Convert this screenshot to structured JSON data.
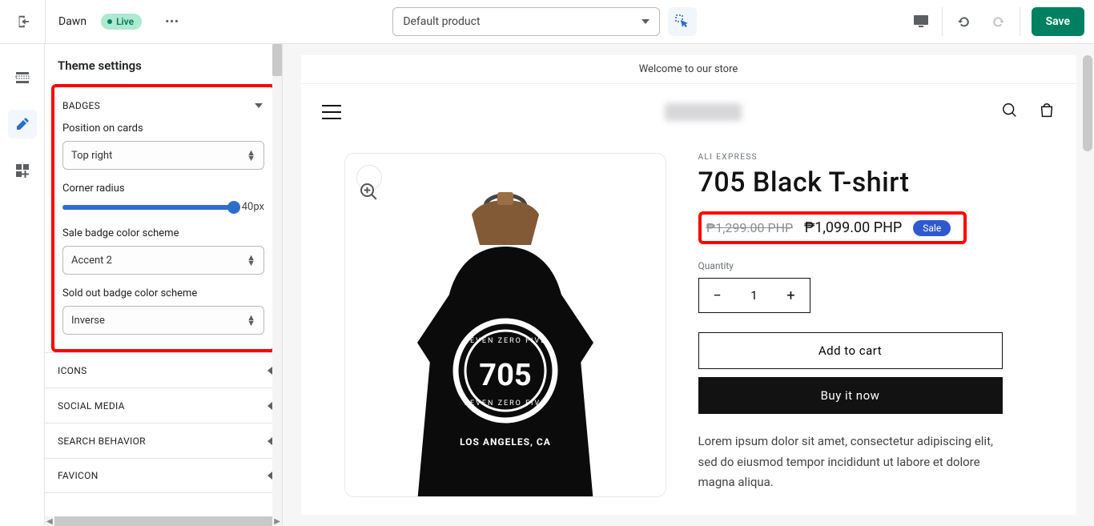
{
  "topbar": {
    "theme_name": "Dawn",
    "status_label": "Live",
    "template_selected": "Default product",
    "save_label": "Save"
  },
  "sidebar": {
    "title": "Theme settings",
    "badges": {
      "header": "BADGES",
      "position_label": "Position on cards",
      "position_value": "Top right",
      "radius_label": "Corner radius",
      "radius_value": "40px",
      "sale_scheme_label": "Sale badge color scheme",
      "sale_scheme_value": "Accent 2",
      "soldout_scheme_label": "Sold out badge color scheme",
      "soldout_scheme_value": "Inverse"
    },
    "sections": [
      "ICONS",
      "SOCIAL MEDIA",
      "SEARCH BEHAVIOR",
      "FAVICON"
    ]
  },
  "preview": {
    "announcement": "Welcome to our store",
    "vendor": "ALI EXPRESS",
    "product_title": "705 Black T-shirt",
    "price_compare": "₱1,299.00 PHP",
    "price": "₱1,099.00 PHP",
    "sale_badge": "Sale",
    "qty_label": "Quantity",
    "qty_value": "1",
    "add_to_cart": "Add to cart",
    "buy_now": "Buy it now",
    "description": "Lorem ipsum dolor sit amet, consectetur adipiscing elit, sed do eiusmod tempor incididunt ut labore et dolore magna aliqua."
  }
}
